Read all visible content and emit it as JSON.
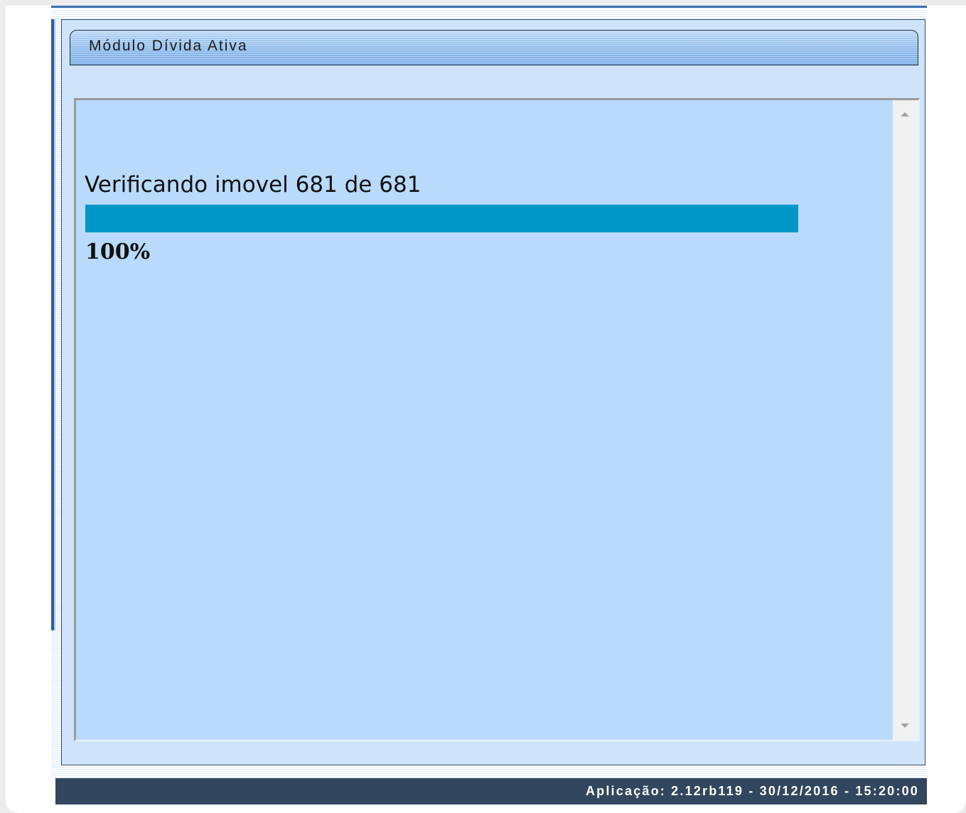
{
  "module": {
    "title": "Módulo Dívida Ativa"
  },
  "progress": {
    "status_text": "Verificando imovel 681 de 681",
    "fraction": 1.0,
    "percent_label": "100%",
    "bar_color": "#0097c6"
  },
  "scrollbar": {
    "up_icon": "scroll-up-arrow",
    "down_icon": "scroll-down-arrow"
  },
  "footer": {
    "text": "Aplicação: 2.12rb119 - 30/12/2016 - 15:20:00"
  },
  "colors": {
    "panel_background": "#cfe4fb",
    "content_background": "#b9dafb",
    "footer_background": "#32475e",
    "header_accent": "#8fbcec"
  }
}
